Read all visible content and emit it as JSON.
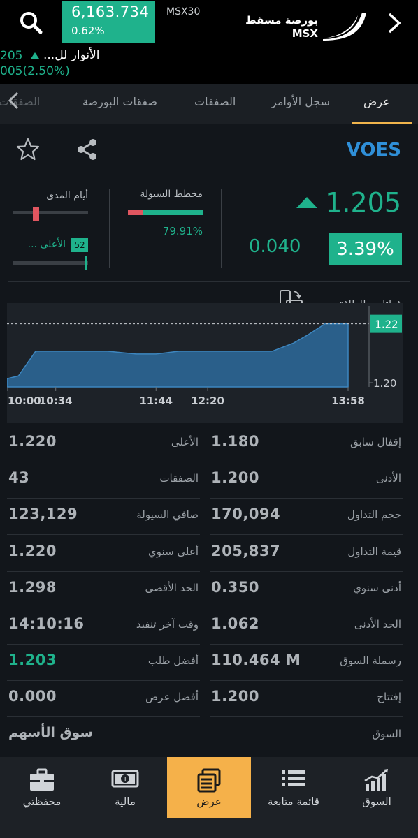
{
  "header": {
    "index_value": "6,163.734",
    "index_change": "0.62%",
    "index_name": "MSX30",
    "exchange_name_ar": "بورصة مسقط",
    "exchange_name_en": "MSX"
  },
  "ticker": {
    "price": "205",
    "name": "الأنوار لل...",
    "change": "005(2.50%)"
  },
  "tabs": [
    {
      "label": "عرض",
      "active": true
    },
    {
      "label": "سجل الأوامر"
    },
    {
      "label": "الصفقات"
    },
    {
      "label": "صفقات البورصة"
    },
    {
      "label": "الصفقات"
    }
  ],
  "stock": {
    "symbol": "VOES",
    "price": "1.205",
    "change": "0.040",
    "change_pct": "3.39%"
  },
  "liquidity": {
    "label": "مخطط السيولة",
    "percent": "79.91%",
    "red_fraction": 0.2
  },
  "range": {
    "days_label": "أيام المدى",
    "days_fraction": 0.3,
    "week52_badge": "52",
    "week52_label": "الأعلى ...",
    "week52_fraction": 0.98
  },
  "chart_data": {
    "type": "area",
    "title": "فولتامبر للطاقة",
    "x_ticks": [
      "10:00",
      "10:34",
      "11:44",
      "12:20",
      "13:58"
    ],
    "y_ticks": [
      "1.22",
      "1.20"
    ],
    "current_label": "1.22",
    "ylim": [
      1.197,
      1.225
    ],
    "points": [
      {
        "t": "10:00",
        "v": 1.2
      },
      {
        "t": "10:08",
        "v": 1.201
      },
      {
        "t": "10:20",
        "v": 1.21
      },
      {
        "t": "11:10",
        "v": 1.21
      },
      {
        "t": "11:30",
        "v": 1.209
      },
      {
        "t": "11:44",
        "v": 1.209
      },
      {
        "t": "12:00",
        "v": 1.21
      },
      {
        "t": "13:05",
        "v": 1.21
      },
      {
        "t": "13:20",
        "v": 1.213
      },
      {
        "t": "13:30",
        "v": 1.216
      },
      {
        "t": "13:42",
        "v": 1.22
      },
      {
        "t": "13:58",
        "v": 1.22
      }
    ]
  },
  "stats": {
    "left": [
      {
        "label": "الأعلى",
        "value": "1.220"
      },
      {
        "label": "الصفقات",
        "value": "43"
      },
      {
        "label": "صافي السيولة",
        "value": "123,129"
      },
      {
        "label": "أعلى سنوي",
        "value": "1.220"
      },
      {
        "label": "الحد الأقصى",
        "value": "1.298"
      },
      {
        "label": "وقت آخر تنفيذ",
        "value": "14:10:16"
      },
      {
        "label": "أفضل طلب",
        "value": "1.203"
      },
      {
        "label": "أفضل عرض",
        "value": "0.000"
      }
    ],
    "right": [
      {
        "label": "إقفال سابق",
        "value": "1.180"
      },
      {
        "label": "الأدنى",
        "value": "1.200"
      },
      {
        "label": "حجم التداول",
        "value": "170,094"
      },
      {
        "label": "قيمة التداول",
        "value": "205,837"
      },
      {
        "label": "أدنى سنوي",
        "value": "0.350"
      },
      {
        "label": "الحد الأدنى",
        "value": "1.062"
      },
      {
        "label": "رسملة السوق",
        "value": "110.464 M"
      },
      {
        "label": "إفتتاح",
        "value": "1.200"
      }
    ],
    "market_label": "السوق",
    "market_value": "سوق الأسهم"
  },
  "nav": [
    {
      "label": "السوق",
      "icon": "market-chart-icon"
    },
    {
      "label": "قائمة متابعة",
      "icon": "watchlist-icon"
    },
    {
      "label": "عرض",
      "icon": "quote-view-icon",
      "active": true
    },
    {
      "label": "مالية",
      "icon": "money-icon"
    },
    {
      "label": "محفظتي",
      "icon": "portfolio-icon"
    }
  ],
  "colors": {
    "up": "#1fb28c",
    "down": "#e05660",
    "accent": "#f5b14a",
    "symbol": "#2f8fd8"
  }
}
